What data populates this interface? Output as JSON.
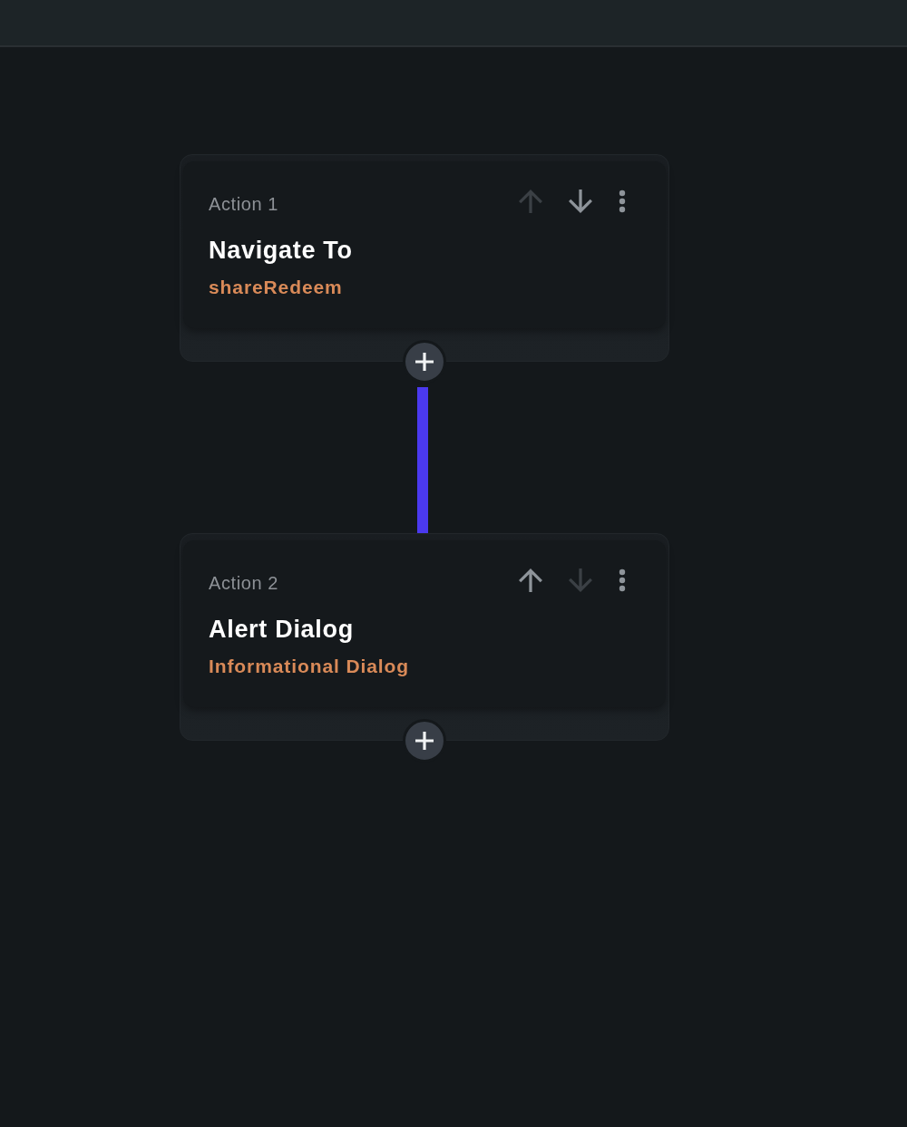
{
  "actions": [
    {
      "label": "Action 1",
      "title": "Navigate To",
      "subtitle": "shareRedeem",
      "move_up": {
        "disabled": true
      },
      "move_down": {
        "disabled": false
      }
    },
    {
      "label": "Action 2",
      "title": "Alert Dialog",
      "subtitle": "Informational Dialog",
      "move_up": {
        "disabled": false
      },
      "move_down": {
        "disabled": true
      }
    }
  ]
}
